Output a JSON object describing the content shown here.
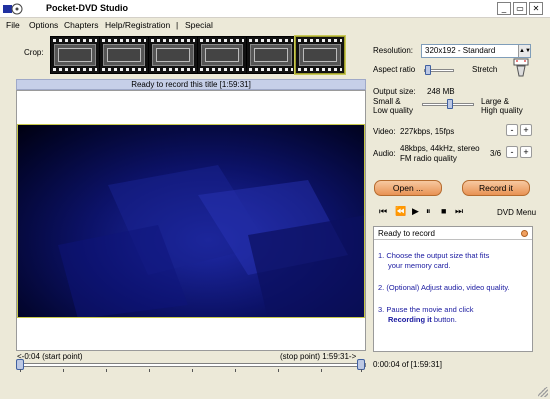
{
  "window": {
    "title": "Pocket-DVD Studio",
    "min": "_",
    "max": "▭",
    "close": "✕"
  },
  "menu": [
    "File",
    "Options",
    "Chapters",
    "Help/Registration",
    "|",
    "Special"
  ],
  "crop": {
    "label": "Crop:",
    "thumbnail_count": 6,
    "selected_index": 5
  },
  "video": {
    "status": "Ready to record this title [1:59:31]",
    "start_label": "<-0:04 (start point)",
    "stop_label": "(stop point) 1:59:31->"
  },
  "settings": {
    "resolution_label": "Resolution:",
    "resolution_value": "320x192 - Standard",
    "aspect_label": "Aspect ratio",
    "aspect_right": "Stretch",
    "output_label": "Output size:",
    "output_value": "248 MB",
    "small_label_1": "Small &",
    "small_label_2": "Low quality",
    "large_label_1": "Large &",
    "large_label_2": "High quality",
    "video_label": "Video:",
    "video_value": "227kbps, 15fps",
    "audio_label": "Audio:",
    "audio_value_1": "48kbps, 44kHz, stereo",
    "audio_value_2": "FM radio quality",
    "audio_counter": "3/6",
    "minus": "-",
    "plus": "+"
  },
  "actions": {
    "open": "Open ...",
    "record": "Record it"
  },
  "controls": {
    "prev": "⏮",
    "rew": "⏪",
    "play": "▶",
    "pause": "⏸",
    "stop": "■",
    "next": "⏭",
    "dvd_menu": "DVD Menu"
  },
  "info": {
    "header": "Ready to record",
    "step1_a": "1. Choose the output size that fits",
    "step1_b": "your memory card.",
    "step2": "2. (Optional) Adjust audio, video quality.",
    "step3_a": "3. Pause the movie and click",
    "step3_b_bold": "Recording it",
    "step3_b_rest": " button."
  },
  "time_readout": "0:00:04 of [1:59:31]",
  "colors": {
    "accent_blue": "#1a1aa0",
    "button_orange": "#e89254",
    "status_bar": "#C6CFE8"
  }
}
